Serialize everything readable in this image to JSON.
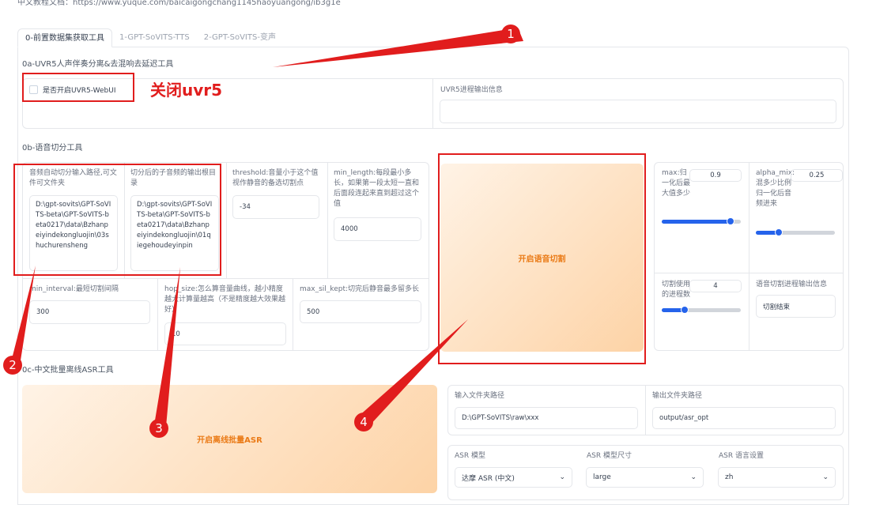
{
  "top_link": "中文教程文档：https://www.yuque.com/baicaigongchang1145haoyuangong/ib3g1e",
  "tabs": [
    "0-前置数据集获取工具",
    "1-GPT-SoVITS-TTS",
    "2-GPT-SoVITS-变声"
  ],
  "uvr": {
    "section_title": "0a-UVR5人声伴奏分离&去混响去延迟工具",
    "checkbox_label": "是否开启UVR5-WebUI",
    "checked": false,
    "output_label": "UVR5进程输出信息",
    "output_value": ""
  },
  "slicer": {
    "section_title": "0b-语音切分工具",
    "input_path_label": "音频自动切分输入路径,可文件可文件夹",
    "input_path_value": "D:\\gpt-sovits\\GPT-SoVITS-beta\\GPT-SoVITS-beta0217\\data\\Bzhanpeiyindekongluojin\\03shuchurensheng",
    "output_dir_label": "切分后的子音频的输出根目录",
    "output_dir_value": "D:\\gpt-sovits\\GPT-SoVITS-beta\\GPT-SoVITS-beta0217\\data\\Bzhanpeiyindekongluojin\\01qiegehoudeyinpin",
    "threshold_label": "threshold:音量小于这个值视作静音的备选切割点",
    "threshold_value": "-34",
    "min_length_label": "min_length:每段最小多长，如果第一段太短一直和后面段连起来直到超过这个值",
    "min_length_value": "4000",
    "min_interval_label": "min_interval:最短切割间隔",
    "min_interval_value": "300",
    "hop_size_label": "hop_size:怎么算音量曲线，越小精度越大计算量越高（不是精度越大效果越好）",
    "hop_size_value": "10",
    "max_sil_kept_label": "max_sil_kept:切完后静音最多留多长",
    "max_sil_kept_value": "500",
    "start_button": "开启语音切割",
    "max_label": "max:归一化后最大值多少",
    "max_value": "0.9",
    "max_fraction": 0.9,
    "alpha_label": "alpha_mix:混多少比例归一化后音频进来",
    "alpha_value": "0.25",
    "alpha_fraction": 0.25,
    "procs_label": "切割使用的进程数",
    "procs_value": "4",
    "procs_fraction": 0.25,
    "output_label": "语音切割进程输出信息",
    "output_value": "切割结束"
  },
  "asr": {
    "section_title": "0c-中文批量离线ASR工具",
    "start_button": "开启离线批量ASR",
    "input_dir_label": "输入文件夹路径",
    "input_dir_value": "D:\\GPT-SoVITS\\raw\\xxx",
    "output_dir_label": "输出文件夹路径",
    "output_dir_value": "output/asr_opt",
    "model_label": "ASR 模型",
    "model_value": "达摩 ASR (中文)",
    "size_label": "ASR 模型尺寸",
    "size_value": "large",
    "lang_label": "ASR 语言设置",
    "lang_value": "zh"
  },
  "annotations": {
    "note": "关闭uvr5",
    "badges": [
      "1",
      "2",
      "3",
      "4"
    ]
  },
  "colors": {
    "annotation_red": "#e11d1d",
    "button_orange": "#ea7a16",
    "slider_blue": "#2563eb"
  }
}
